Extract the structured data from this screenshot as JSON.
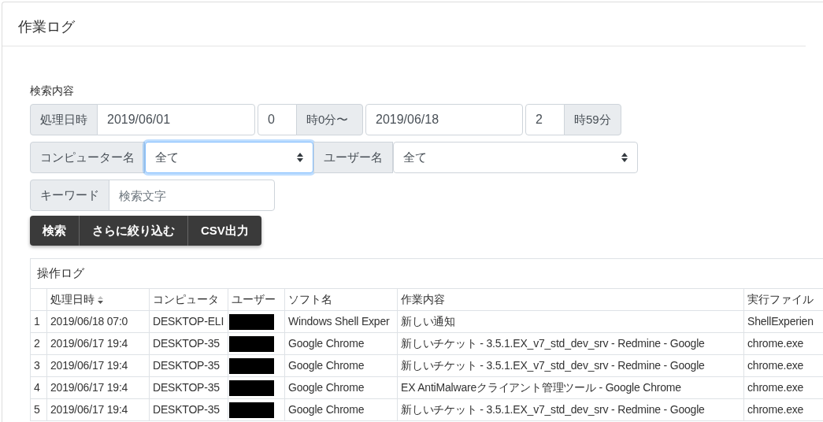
{
  "page_title": "作業ログ",
  "search": {
    "heading": "検索内容",
    "date_label": "処理日時",
    "start_date": "2019/06/01",
    "start_hour": "0",
    "start_suffix": "時0分〜",
    "end_date": "2019/06/18",
    "end_hour": "2",
    "end_suffix": "時59分",
    "selects": [
      {
        "label": "コンピューター名",
        "value": "全て",
        "focused": true
      },
      {
        "label": "ユーザー名",
        "value": "全て",
        "focused": false
      }
    ],
    "keyword_label": "キーワード",
    "keyword_placeholder": "検索文字",
    "buttons": [
      "検索",
      "さらに絞り込む",
      "CSV出力"
    ]
  },
  "table": {
    "title": "操作ログ",
    "columns": [
      {
        "sortable": false
      },
      {
        "label": "処理日時",
        "sortable": true
      },
      {
        "label": "コンピュータ",
        "sortable": false
      },
      {
        "label": "ユーザー",
        "sortable": false
      },
      {
        "label": "ソフト名",
        "sortable": false
      },
      {
        "label": "作業内容",
        "sortable": false
      },
      {
        "label": "実行ファイル",
        "sortable": false
      }
    ],
    "rows": [
      {
        "index": "1",
        "date": "2019/06/18 07:0",
        "computer": "DESKTOP-ELI",
        "user_redacted": true,
        "software": "Windows Shell Exper",
        "content": "新しい通知",
        "exe": "ShellExperien"
      },
      {
        "index": "2",
        "date": "2019/06/17 19:4",
        "computer": "DESKTOP-35",
        "user_redacted": true,
        "software": "Google Chrome",
        "content": "新しいチケット - 3.5.1.EX_v7_std_dev_srv - Redmine - Google",
        "exe": "chrome.exe"
      },
      {
        "index": "3",
        "date": "2019/06/17 19:4",
        "computer": "DESKTOP-35",
        "user_redacted": true,
        "software": "Google Chrome",
        "content": "新しいチケット - 3.5.1.EX_v7_std_dev_srv - Redmine - Google",
        "exe": "chrome.exe"
      },
      {
        "index": "4",
        "date": "2019/06/17 19:4",
        "computer": "DESKTOP-35",
        "user_redacted": true,
        "software": "Google Chrome",
        "content": "EX AntiMalwareクライアント管理ツール - Google Chrome",
        "exe": "chrome.exe"
      },
      {
        "index": "5",
        "date": "2019/06/17 19:4",
        "computer": "DESKTOP-35",
        "user_redacted": true,
        "software": "Google Chrome",
        "content": "新しいチケット - 3.5.1.EX_v7_std_dev_srv - Redmine - Google",
        "exe": "chrome.exe"
      }
    ]
  }
}
